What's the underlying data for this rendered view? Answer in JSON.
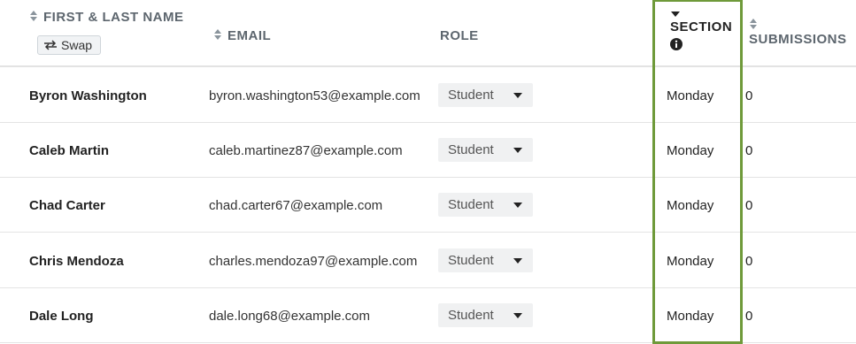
{
  "columns": {
    "name": "FIRST & LAST NAME",
    "swap_label": "Swap",
    "email": "EMAIL",
    "role": "ROLE",
    "section": "SECTION",
    "submissions": "SUBMISSIONS"
  },
  "highlight_color": "#6f9a3a",
  "rows": [
    {
      "name": "Byron Washington",
      "email": "byron.washington53@example.com",
      "role": "Student",
      "section": "Monday",
      "submissions": "0"
    },
    {
      "name": "Caleb Martin",
      "email": "caleb.martinez87@example.com",
      "role": "Student",
      "section": "Monday",
      "submissions": "0"
    },
    {
      "name": "Chad Carter",
      "email": "chad.carter67@example.com",
      "role": "Student",
      "section": "Monday",
      "submissions": "0"
    },
    {
      "name": "Chris Mendoza",
      "email": "charles.mendoza97@example.com",
      "role": "Student",
      "section": "Monday",
      "submissions": "0"
    },
    {
      "name": "Dale Long",
      "email": "dale.long68@example.com",
      "role": "Student",
      "section": "Monday",
      "submissions": "0"
    }
  ]
}
